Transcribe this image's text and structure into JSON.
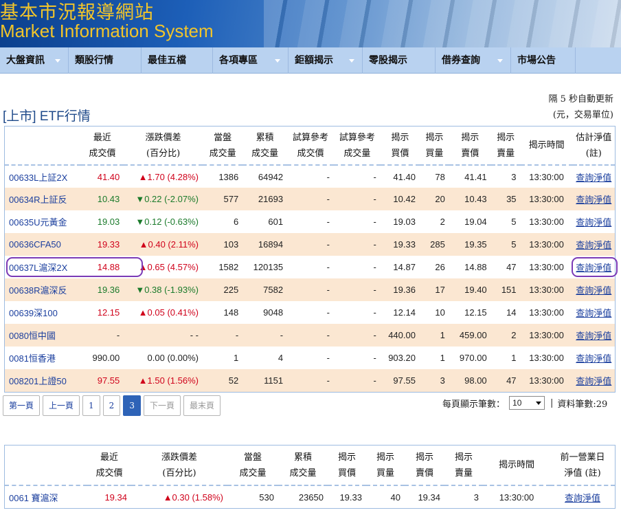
{
  "banner": {
    "title_zh": "基本市況報導網站",
    "title_en": "Market Information System"
  },
  "nav": [
    {
      "label": "大盤資訊",
      "dropdown": true
    },
    {
      "label": "類股行情",
      "dropdown": false
    },
    {
      "label": "最佳五檔",
      "dropdown": false
    },
    {
      "label": "各項專區",
      "dropdown": true
    },
    {
      "label": "鉅額揭示",
      "dropdown": true
    },
    {
      "label": "零股揭示",
      "dropdown": false
    },
    {
      "label": "借券查詢",
      "dropdown": true
    },
    {
      "label": "市場公告",
      "dropdown": false
    }
  ],
  "header": {
    "auto_refresh": "隔 5 秒自動更新",
    "unit_note": "(元，交易單位)",
    "title": "[上市] ETF行情"
  },
  "main_table": {
    "columns": [
      {
        "l1": "",
        "l2": ""
      },
      {
        "l1": "最近",
        "l2": "成交價"
      },
      {
        "l1": "漲跌價差",
        "l2": "(百分比)"
      },
      {
        "l1": "當盤",
        "l2": "成交量"
      },
      {
        "l1": "累積",
        "l2": "成交量"
      },
      {
        "l1": "試算參考",
        "l2": "成交價"
      },
      {
        "l1": "試算參考",
        "l2": "成交量"
      },
      {
        "l1": "揭示",
        "l2": "買價"
      },
      {
        "l1": "揭示",
        "l2": "買量"
      },
      {
        "l1": "揭示",
        "l2": "賣價"
      },
      {
        "l1": "揭示",
        "l2": "賣量"
      },
      {
        "l1": "揭示時間",
        "l2": ""
      },
      {
        "l1": "估計淨值",
        "l2": "(註)"
      }
    ],
    "rows": [
      {
        "name": "00633L上証2X",
        "price": "41.40",
        "dir": "up",
        "change": "▲1.70 (4.28%)",
        "vol": "1386",
        "cum": "64942",
        "tp": "-",
        "tv": "-",
        "bid": "41.40",
        "bidv": "78",
        "ask": "41.41",
        "askv": "3",
        "time": "13:30:00",
        "link": "查詢淨值"
      },
      {
        "name": "00634R上証反",
        "price": "10.43",
        "dir": "down",
        "change": "▼0.22 (-2.07%)",
        "vol": "577",
        "cum": "21693",
        "tp": "-",
        "tv": "-",
        "bid": "10.42",
        "bidv": "20",
        "ask": "10.43",
        "askv": "35",
        "time": "13:30:00",
        "link": "查詢淨值"
      },
      {
        "name": "00635U元黃金",
        "price": "19.03",
        "dir": "down",
        "change": "▼0.12 (-0.63%)",
        "vol": "6",
        "cum": "601",
        "tp": "-",
        "tv": "-",
        "bid": "19.03",
        "bidv": "2",
        "ask": "19.04",
        "askv": "5",
        "time": "13:30:00",
        "link": "查詢淨值"
      },
      {
        "name": "00636CFA50",
        "price": "19.33",
        "dir": "up",
        "change": "▲0.40 (2.11%)",
        "vol": "103",
        "cum": "16894",
        "tp": "-",
        "tv": "-",
        "bid": "19.33",
        "bidv": "285",
        "ask": "19.35",
        "askv": "5",
        "time": "13:30:00",
        "link": "查詢淨值"
      },
      {
        "name": "00637L滬深2X",
        "price": "14.88",
        "dir": "up",
        "change": "▲0.65 (4.57%)",
        "vol": "1582",
        "cum": "120135",
        "tp": "-",
        "tv": "-",
        "bid": "14.87",
        "bidv": "26",
        "ask": "14.88",
        "askv": "47",
        "time": "13:30:00",
        "link": "查詢淨值",
        "highlight": true
      },
      {
        "name": "00638R滬深反",
        "price": "19.36",
        "dir": "down",
        "change": "▼0.38 (-1.93%)",
        "vol": "225",
        "cum": "7582",
        "tp": "-",
        "tv": "-",
        "bid": "19.36",
        "bidv": "17",
        "ask": "19.40",
        "askv": "151",
        "time": "13:30:00",
        "link": "查詢淨值"
      },
      {
        "name": "00639深100",
        "price": "12.15",
        "dir": "up",
        "change": "▲0.05 (0.41%)",
        "vol": "148",
        "cum": "9048",
        "tp": "-",
        "tv": "-",
        "bid": "12.14",
        "bidv": "10",
        "ask": "12.15",
        "askv": "14",
        "time": "13:30:00",
        "link": "查詢淨值"
      },
      {
        "name": "0080恒中國",
        "price": "-",
        "dir": "plain",
        "change": "- -",
        "vol": "-",
        "cum": "-",
        "tp": "-",
        "tv": "-",
        "bid": "440.00",
        "bidv": "1",
        "ask": "459.00",
        "askv": "2",
        "time": "13:30:00",
        "link": "查詢淨值"
      },
      {
        "name": "0081恒香港",
        "price": "990.00",
        "dir": "plain",
        "change": "0.00 (0.00%)",
        "vol": "1",
        "cum": "4",
        "tp": "-",
        "tv": "-",
        "bid": "903.20",
        "bidv": "1",
        "ask": "970.00",
        "askv": "1",
        "time": "13:30:00",
        "link": "查詢淨值"
      },
      {
        "name": "008201上證50",
        "price": "97.55",
        "dir": "up",
        "change": "▲1.50 (1.56%)",
        "vol": "52",
        "cum": "1151",
        "tp": "-",
        "tv": "-",
        "bid": "97.55",
        "bidv": "3",
        "ask": "98.00",
        "askv": "47",
        "time": "13:30:00",
        "link": "查詢淨值"
      }
    ]
  },
  "pager": {
    "buttons": [
      {
        "label": "第一頁",
        "state": "normal"
      },
      {
        "label": "上一頁",
        "state": "normal"
      },
      {
        "label": "1",
        "state": "normal"
      },
      {
        "label": "2",
        "state": "normal"
      },
      {
        "label": "3",
        "state": "active"
      },
      {
        "label": "下一頁",
        "state": "disabled"
      },
      {
        "label": "最末頁",
        "state": "disabled"
      }
    ],
    "page_size_label": "每頁顯示筆數：",
    "page_size_value": "10",
    "separator": "|",
    "record_count": "資料筆數:29"
  },
  "second_table": {
    "columns": [
      {
        "l1": "",
        "l2": ""
      },
      {
        "l1": "最近",
        "l2": "成交價"
      },
      {
        "l1": "漲跌價差",
        "l2": "(百分比)"
      },
      {
        "l1": "當盤",
        "l2": "成交量"
      },
      {
        "l1": "累積",
        "l2": "成交量"
      },
      {
        "l1": "揭示",
        "l2": "買價"
      },
      {
        "l1": "揭示",
        "l2": "買量"
      },
      {
        "l1": "揭示",
        "l2": "賣價"
      },
      {
        "l1": "揭示",
        "l2": "賣量"
      },
      {
        "l1": "揭示時間",
        "l2": ""
      },
      {
        "l1": "前一營業日",
        "l2": "淨值 (註)"
      }
    ],
    "rows": [
      {
        "name": "0061 寶滬深",
        "price": "19.34",
        "dir": "up",
        "change": "▲0.30 (1.58%)",
        "vol": "530",
        "cum": "23650",
        "bid": "19.33",
        "bidv": "40",
        "ask": "19.34",
        "askv": "3",
        "time": "13:30:00",
        "link": "查詢淨值"
      }
    ]
  }
}
